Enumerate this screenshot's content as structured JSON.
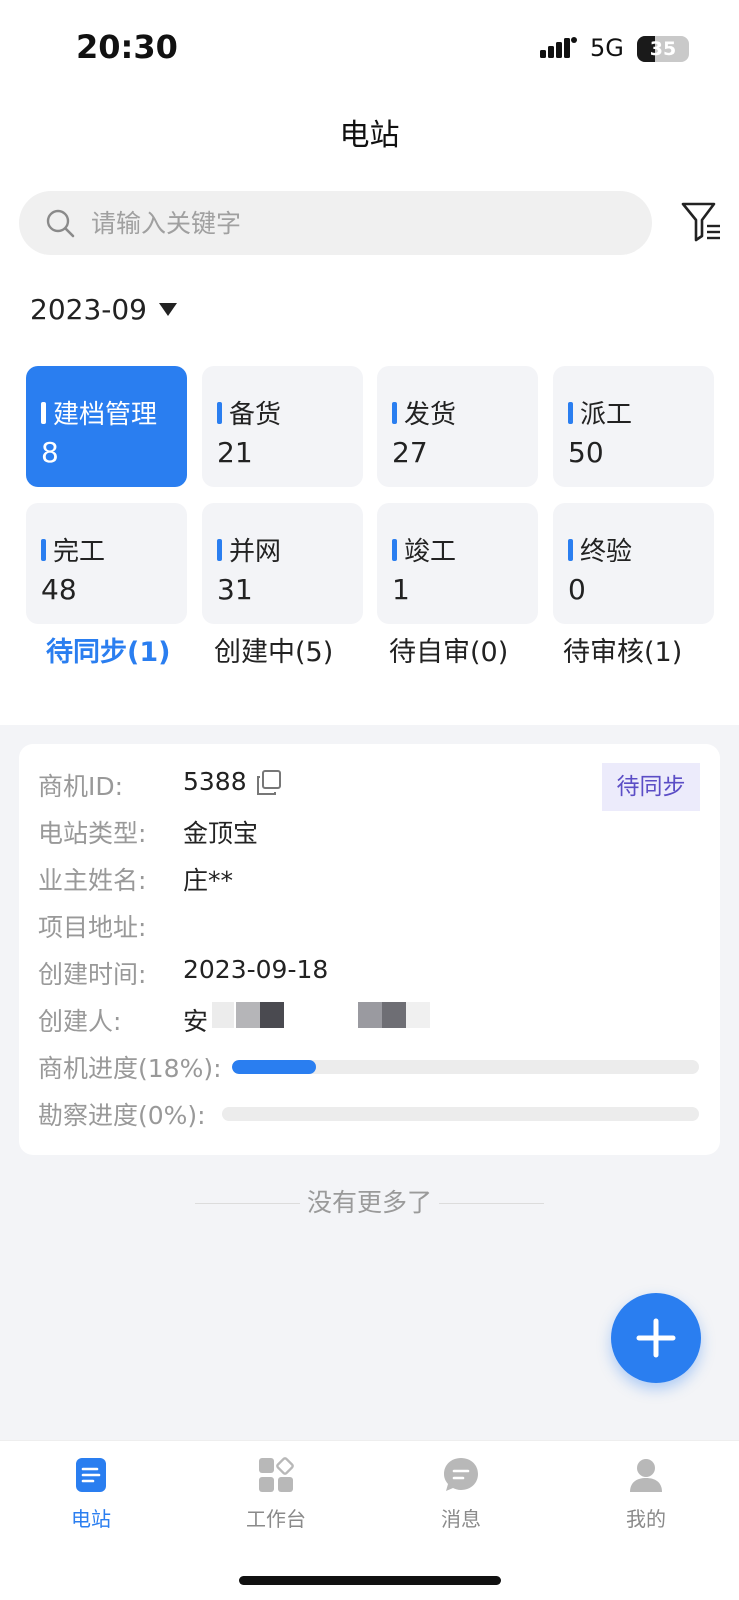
{
  "status_bar": {
    "time": "20:30",
    "network": "5G",
    "battery": "35",
    "battery_level": 0.35
  },
  "header": {
    "title": "电站"
  },
  "search": {
    "placeholder": "请输入关键字"
  },
  "date_filter": {
    "value": "2023-09"
  },
  "tiles": [
    {
      "label": "建档管理",
      "count": "8",
      "active": true
    },
    {
      "label": "备货",
      "count": "21"
    },
    {
      "label": "发货",
      "count": "27"
    },
    {
      "label": "派工",
      "count": "50"
    },
    {
      "label": "完工",
      "count": "48"
    },
    {
      "label": "并网",
      "count": "31"
    },
    {
      "label": "竣工",
      "count": "1"
    },
    {
      "label": "终验",
      "count": "0"
    }
  ],
  "tabs": [
    {
      "label": "待同步(1)",
      "active": true
    },
    {
      "label": "创建中(5)"
    },
    {
      "label": "待自审(0)"
    },
    {
      "label": "待审核(1)"
    }
  ],
  "card": {
    "badge": "待同步",
    "fields": {
      "opportunity_id_label": "商机ID:",
      "opportunity_id": "5388",
      "station_type_label": "电站类型:",
      "station_type": "金顶宝",
      "owner_label": "业主姓名:",
      "owner": "庄**",
      "address_label": "项目地址:",
      "address": "",
      "created_label": "创建时间:",
      "created": "2023-09-18",
      "creator_label": "创建人:",
      "creator": "安"
    },
    "opportunity_progress_label": "商机进度(18%):",
    "opportunity_progress": 0.18,
    "survey_progress_label": "勘察进度(0%):",
    "survey_progress": 0.0
  },
  "list_footer": "没有更多了",
  "bottom_nav": [
    {
      "label": "电站",
      "icon": "document-icon",
      "active": true
    },
    {
      "label": "工作台",
      "icon": "grid-icon"
    },
    {
      "label": "消息",
      "icon": "chat-icon"
    },
    {
      "label": "我的",
      "icon": "user-icon"
    }
  ],
  "colors": {
    "accent": "#2a7ef0",
    "badge_text": "#5b4dc6",
    "badge_bg": "#ecebfb",
    "page_bg": "#f3f4f7"
  }
}
